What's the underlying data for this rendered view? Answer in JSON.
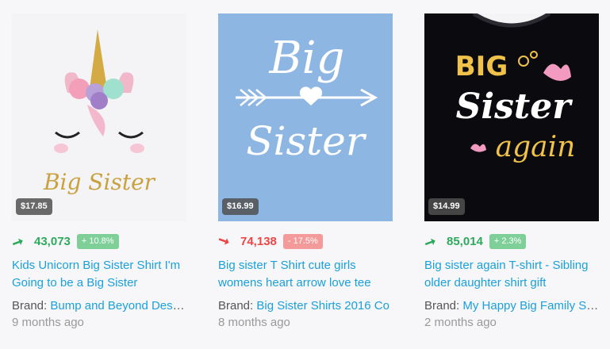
{
  "products": [
    {
      "price": "$17.85",
      "trend": "up",
      "arrow": "➞",
      "rank": "43,073",
      "delta": "+ 10.8%",
      "title": "Kids Unicorn Big Sister Shirt I'm Going to be a Big Sister",
      "brand_label": "Brand:",
      "brand": "Bump and Beyond Designs",
      "age": "9 months ago",
      "image_text": "Big Sister"
    },
    {
      "price": "$16.99",
      "trend": "down",
      "arrow": "➞",
      "rank": "74,138",
      "delta": "- 17.5%",
      "title": "Big sister T Shirt cute girls womens heart arrow love tee",
      "brand_label": "Brand:",
      "brand": "Big Sister Shirts 2016 Co",
      "age": "8 months ago",
      "image_text_1": "Big",
      "image_text_2": "Sister"
    },
    {
      "price": "$14.99",
      "trend": "up",
      "arrow": "➞",
      "rank": "85,014",
      "delta": "+ 2.3%",
      "title": "Big sister again T-shirt - Sibling older daughter shirt gift",
      "brand_label": "Brand:",
      "brand": "My Happy Big Family Shirts",
      "age": "2 months ago",
      "image_text_1": "BIG",
      "image_text_2": "Sister",
      "image_text_3": "again"
    }
  ],
  "colors": {
    "link": "#1aa0dc",
    "up": "#2eaa5c",
    "down": "#ee4444"
  }
}
